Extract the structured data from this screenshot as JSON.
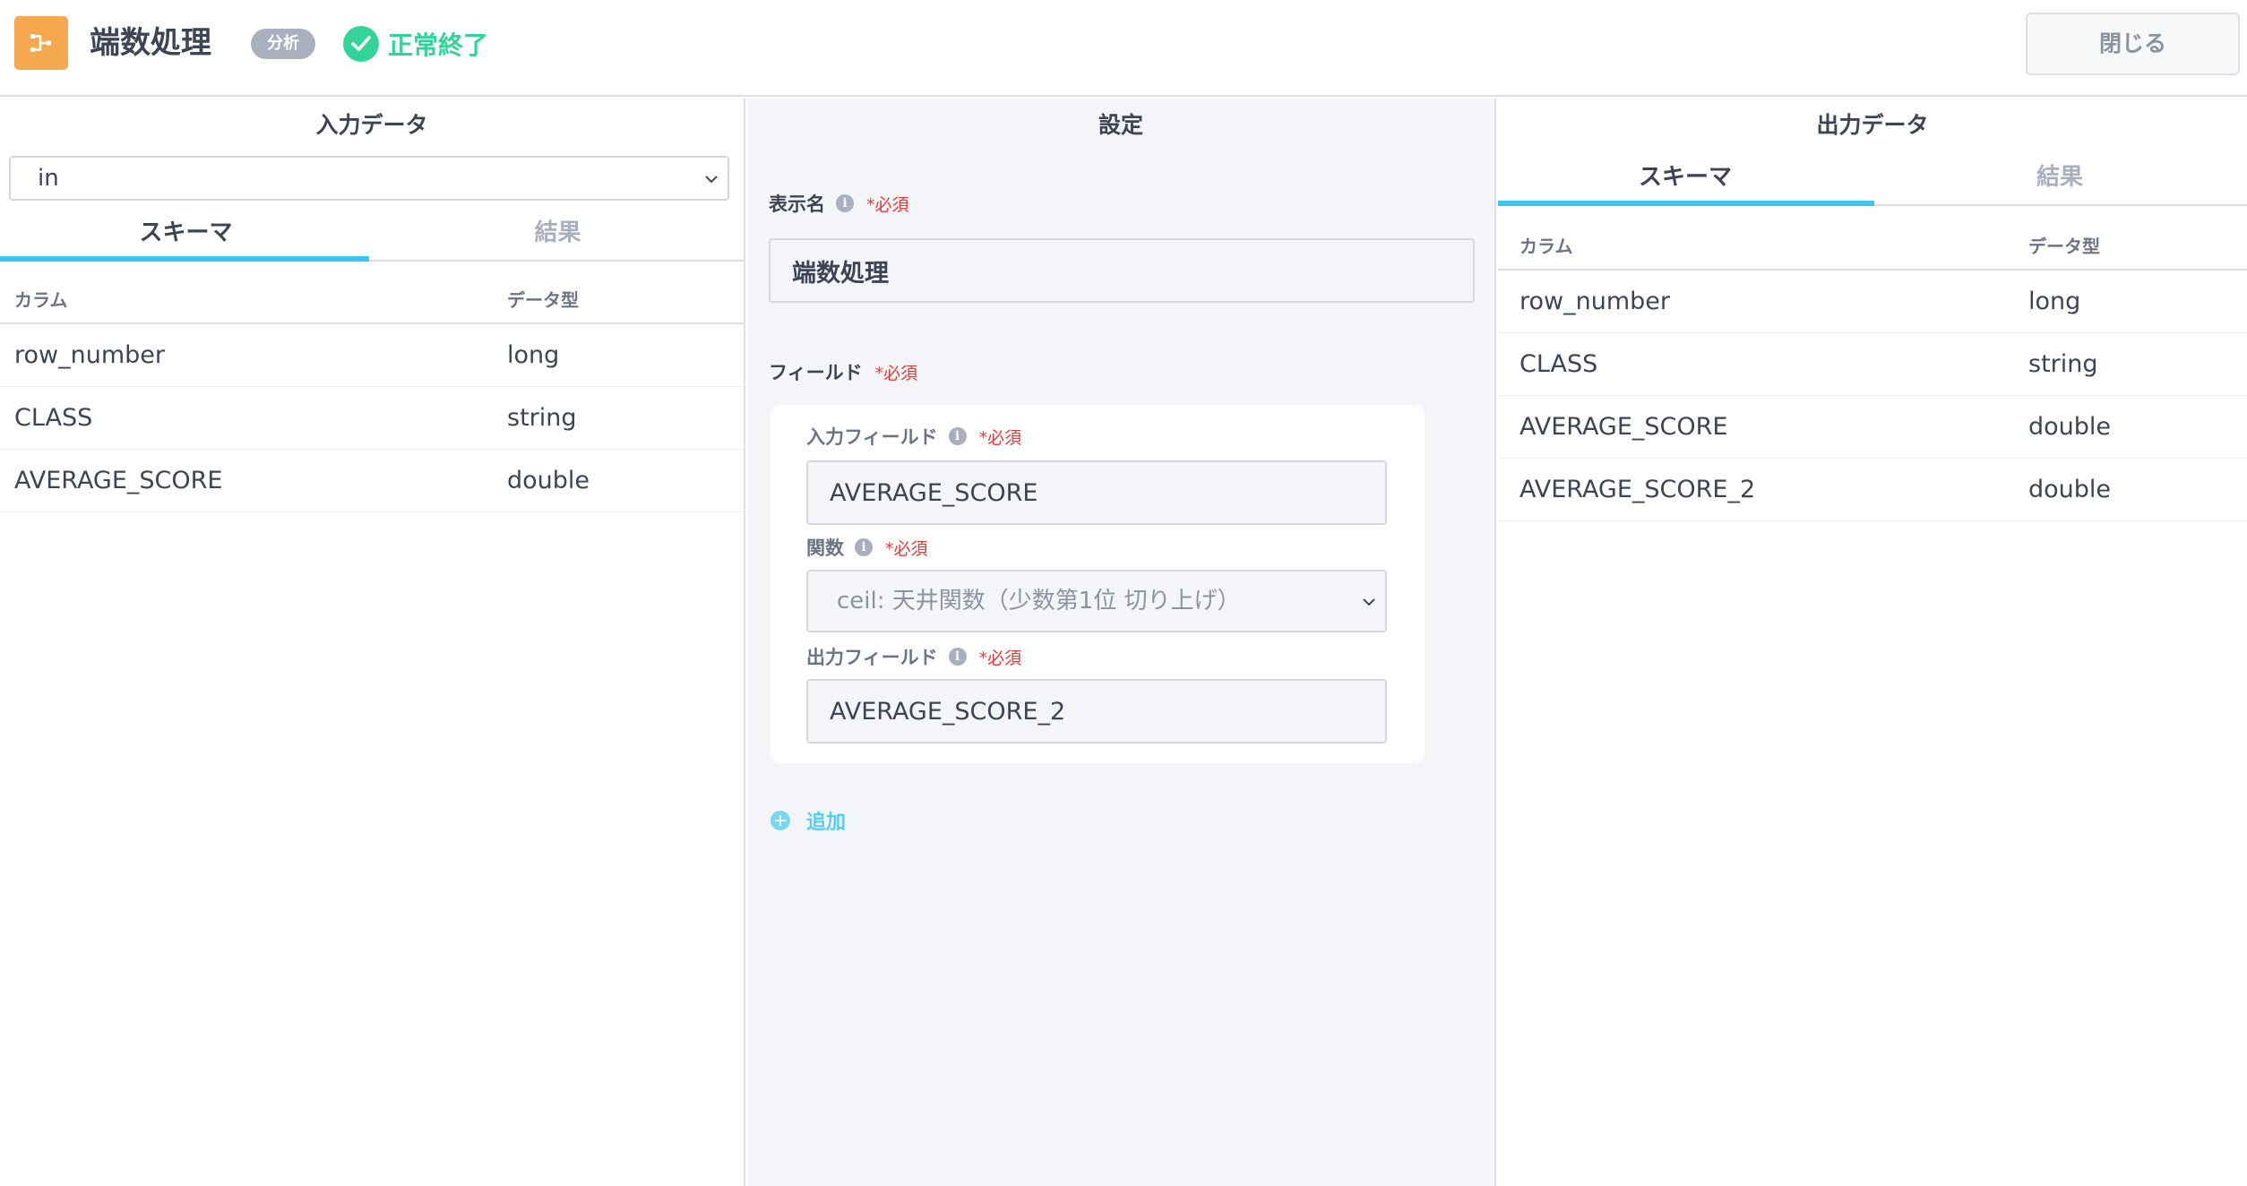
{
  "header": {
    "title": "端数処理",
    "category": "分析",
    "status": "正常終了",
    "close_label": "閉じる",
    "accent_color": "#f6a84f",
    "status_color": "#34d399"
  },
  "input_panel": {
    "title": "入力データ",
    "selected_input": "in",
    "tabs": [
      "スキーマ",
      "結果"
    ],
    "columns": [
      "カラム",
      "データ型"
    ],
    "rows": [
      {
        "name": "row_number",
        "type": "long"
      },
      {
        "name": "CLASS",
        "type": "string"
      },
      {
        "name": "AVERAGE_SCORE",
        "type": "double"
      }
    ]
  },
  "settings_panel": {
    "title": "設定",
    "display_name_label": "表示名",
    "required_label": "*必須",
    "display_name_value": "端数処理",
    "fields_label": "フィールド",
    "input_field_label": "入力フィールド",
    "input_field_value": "AVERAGE_SCORE",
    "function_label": "関数",
    "function_value": "ceil: 天井関数（少数第1位 切り上げ）",
    "output_field_label": "出力フィールド",
    "output_field_value": "AVERAGE_SCORE_2",
    "add_label": "追加"
  },
  "output_panel": {
    "title": "出力データ",
    "tabs": [
      "スキーマ",
      "結果"
    ],
    "columns": [
      "カラム",
      "データ型"
    ],
    "rows": [
      {
        "name": "row_number",
        "type": "long"
      },
      {
        "name": "CLASS",
        "type": "string"
      },
      {
        "name": "AVERAGE_SCORE",
        "type": "double"
      },
      {
        "name": "AVERAGE_SCORE_2",
        "type": "double"
      }
    ]
  }
}
